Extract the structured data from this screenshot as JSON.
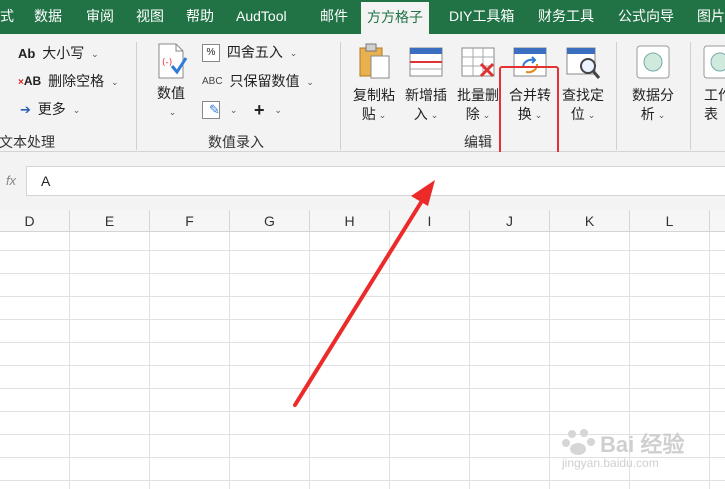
{
  "menu": {
    "tabs": [
      "式",
      "数据",
      "审阅",
      "视图",
      "帮助",
      "AudTool",
      "邮件",
      "方方格子",
      "DIY工具箱",
      "财务工具",
      "公式向导",
      "图片"
    ],
    "active_tab": "方方格子"
  },
  "ribbon": {
    "text_group": {
      "items": [
        "大小写",
        "删除空格",
        "更多"
      ],
      "label": "文本处理"
    },
    "number_group": {
      "value_button": "数值",
      "items": [
        "四舍五入",
        "只保留数值"
      ],
      "label": "数值录入"
    },
    "edit_group": {
      "buttons": [
        {
          "line1": "复制粘",
          "line2": "贴"
        },
        {
          "line1": "新增插",
          "line2": "入"
        },
        {
          "line1": "批量删",
          "line2": "除"
        },
        {
          "line1": "合并转",
          "line2": "换"
        },
        {
          "line1": "查找定",
          "line2": "位"
        }
      ],
      "label": "编辑"
    },
    "analysis": {
      "line1": "数据分",
      "line2": "析"
    },
    "work": {
      "line1": "工作",
      "line2": "表"
    }
  },
  "formula_bar": {
    "fx": "fx",
    "value": "A"
  },
  "grid": {
    "columns": [
      "D",
      "E",
      "F",
      "G",
      "H",
      "I",
      "J",
      "K",
      "L"
    ]
  },
  "colors": {
    "menubar": "#217346",
    "highlight": "#e3322f",
    "arrow": "#ec2a2a"
  },
  "watermark": {
    "text": "Bai 经验",
    "url": "jingyan.baidu.com"
  }
}
